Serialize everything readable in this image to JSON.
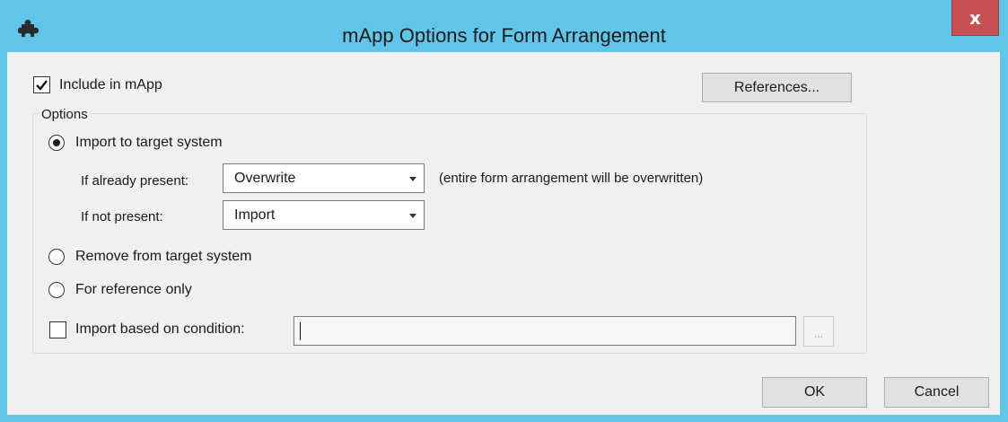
{
  "window": {
    "title": "mApp Options for Form Arrangement",
    "close_label": "x",
    "app_icon": "puzzle-icon",
    "accent_color": "#5fc6ea",
    "close_color": "#c75050"
  },
  "include": {
    "label": "Include in mApp",
    "checked": true
  },
  "references_button": "References...",
  "options_group": {
    "legend": "Options",
    "import_radio": "Import to target system",
    "already_present_label": "If already present:",
    "already_present_value": "Overwrite",
    "already_present_note": "(entire form arrangement will be overwritten)",
    "not_present_label": "If not present:",
    "not_present_value": "Import",
    "remove_radio": "Remove from target system",
    "reference_radio": "For reference only",
    "condition_label": "Import based on condition:",
    "condition_value": "",
    "condition_browse": "..."
  },
  "footer": {
    "ok_label": "OK",
    "cancel_label": "Cancel"
  }
}
